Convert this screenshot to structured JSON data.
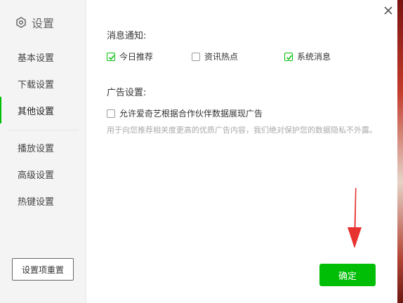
{
  "sidebar": {
    "title": "设置",
    "items": [
      {
        "label": "基本设置",
        "active": false
      },
      {
        "label": "下载设置",
        "active": false
      },
      {
        "label": "其他设置",
        "active": true
      },
      {
        "label": "播放设置",
        "active": false
      },
      {
        "label": "高级设置",
        "active": false
      },
      {
        "label": "热键设置",
        "active": false
      }
    ],
    "reset_label": "设置项重置"
  },
  "notifications": {
    "title": "消息通知:",
    "options": [
      {
        "label": "今日推荐",
        "checked": true
      },
      {
        "label": "资讯热点",
        "checked": false
      },
      {
        "label": "系统消息",
        "checked": true
      }
    ]
  },
  "ads": {
    "title": "广告设置:",
    "option": {
      "label": "允许爱奇艺根据合作伙伴数据展现广告",
      "checked": false
    },
    "hint": "用于向您推荐相关度更高的优质广告内容，我们绝对保护您的数据隐私不外露。"
  },
  "confirm_label": "确定",
  "colors": {
    "accent": "#00be06",
    "annotation_arrow": "#e8322f"
  }
}
